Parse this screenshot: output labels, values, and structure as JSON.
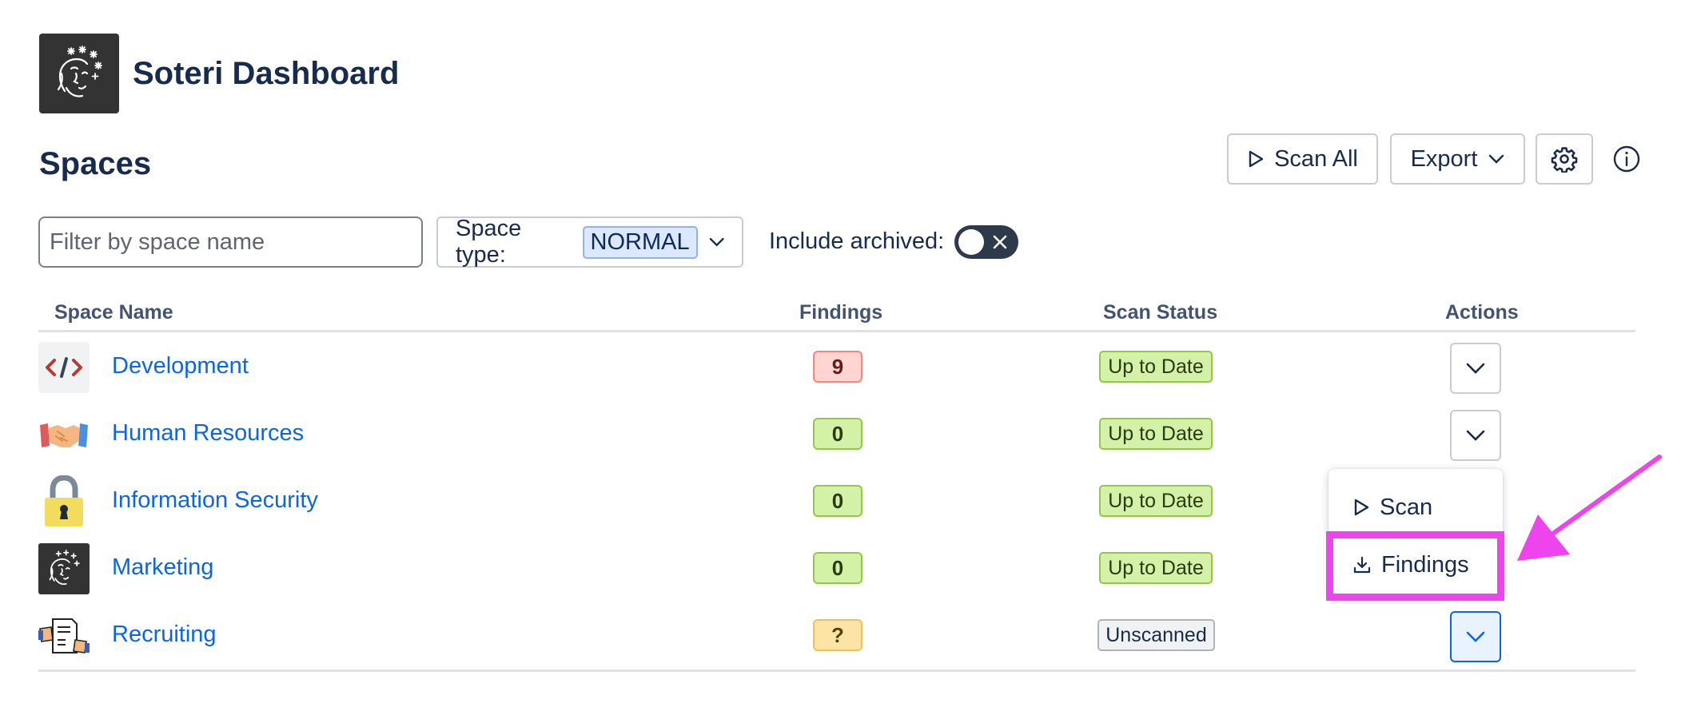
{
  "app": {
    "title": "Soteri Dashboard",
    "logo_icon": "face-sparkles-logo"
  },
  "page": {
    "title": "Spaces"
  },
  "toolbar": {
    "scan_all_label": "Scan All",
    "export_label": "Export",
    "settings_icon": "gear-icon",
    "info_icon": "info-icon"
  },
  "filters": {
    "name_placeholder": "Filter by space name",
    "name_value": "",
    "space_type_label": "Space type:",
    "space_type_value": "NORMAL",
    "include_archived_label": "Include archived:",
    "include_archived": false
  },
  "table": {
    "columns": [
      "Space Name",
      "Findings",
      "Scan Status",
      "Actions"
    ],
    "rows": [
      {
        "name": "Development",
        "icon": "code-icon",
        "findings": "9",
        "findings_level": "red",
        "status": "Up to Date"
      },
      {
        "name": "Human Resources",
        "icon": "handshake-icon",
        "findings": "0",
        "findings_level": "green",
        "status": "Up to Date"
      },
      {
        "name": "Information Security",
        "icon": "padlock-icon",
        "findings": "0",
        "findings_level": "green",
        "status": "Up to Date"
      },
      {
        "name": "Marketing",
        "icon": "face-sparkles-icon",
        "findings": "0",
        "findings_level": "green",
        "status": "Up to Date"
      },
      {
        "name": "Recruiting",
        "icon": "document-hands-icon",
        "findings": "?",
        "findings_level": "yellow",
        "status": "Unscanned"
      }
    ]
  },
  "actions_menu": {
    "items": [
      {
        "label": "Scan",
        "icon": "play-icon"
      },
      {
        "label": "Findings",
        "icon": "download-icon"
      }
    ]
  },
  "colors": {
    "link": "#0c66e4",
    "highlight": "#ee44ee",
    "toggle_off": "#2c3a4b"
  }
}
